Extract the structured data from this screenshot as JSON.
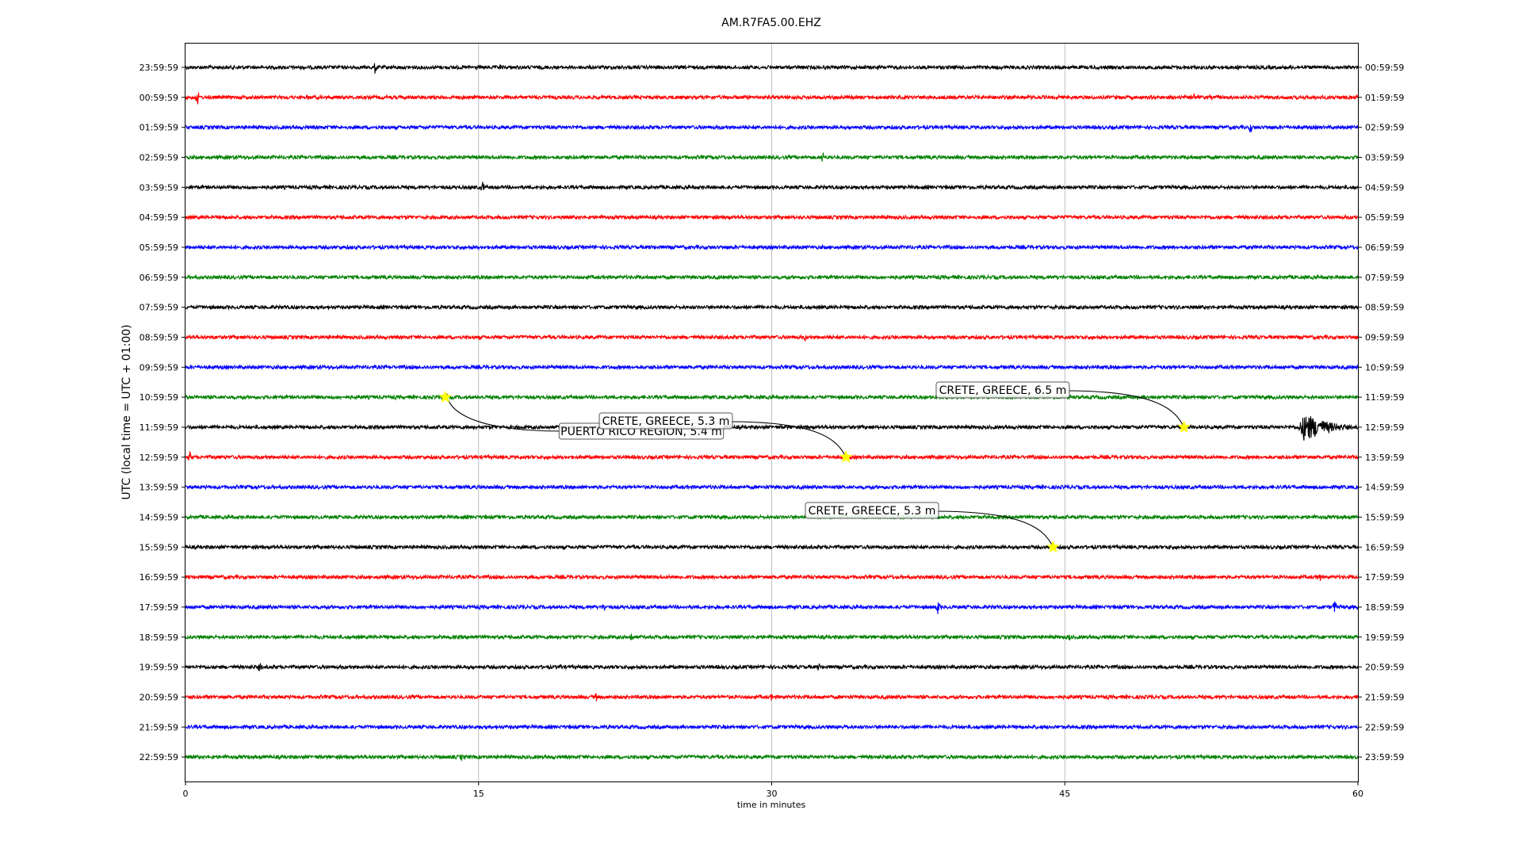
{
  "chart_data": {
    "type": "line",
    "title": "AM.R7FA5.00.EHZ",
    "xlabel": "time in minutes",
    "ylabel": "UTC (local time = UTC + 01:00)",
    "xlim": [
      0,
      60
    ],
    "xticks": [
      "0",
      "15",
      "30",
      "45",
      "60"
    ],
    "xtick_values": [
      0,
      15,
      30,
      45,
      60
    ],
    "grid_x": true,
    "grid_y": false,
    "line_colors": [
      "#000000",
      "#ff0000",
      "#0000ff",
      "#008000"
    ],
    "marker_color": "#ffff00",
    "left_labels": [
      "23:59:59",
      "00:59:59",
      "01:59:59",
      "02:59:59",
      "03:59:59",
      "04:59:59",
      "05:59:59",
      "06:59:59",
      "07:59:59",
      "08:59:59",
      "09:59:59",
      "10:59:59",
      "11:59:59",
      "12:59:59",
      "13:59:59",
      "14:59:59",
      "15:59:59",
      "16:59:59",
      "17:59:59",
      "18:59:59",
      "19:59:59",
      "20:59:59",
      "21:59:59",
      "22:59:59"
    ],
    "right_labels": [
      "00:59:59",
      "01:59:59",
      "02:59:59",
      "03:59:59",
      "04:59:59",
      "05:59:59",
      "06:59:59",
      "07:59:59",
      "08:59:59",
      "09:59:59",
      "10:59:59",
      "11:59:59",
      "12:59:59",
      "13:59:59",
      "14:59:59",
      "15:59:59",
      "16:59:59",
      "17:59:59",
      "18:59:59",
      "19:59:59",
      "20:59:59",
      "21:59:59",
      "22:59:59",
      "23:59:59"
    ],
    "spikes": [
      {
        "row": 0,
        "minute": 9.7,
        "amp": 0.5
      },
      {
        "row": 0,
        "minute": 16.1,
        "amp": 0.25
      },
      {
        "row": 1,
        "minute": 0.6,
        "amp": 0.6
      },
      {
        "row": 1,
        "minute": 51.6,
        "amp": 0.35
      },
      {
        "row": 2,
        "minute": 54.5,
        "amp": 0.45
      },
      {
        "row": 3,
        "minute": 32.6,
        "amp": 0.5
      },
      {
        "row": 4,
        "minute": 15.2,
        "amp": 0.5
      },
      {
        "row": 9,
        "minute": 31.7,
        "amp": 0.3
      },
      {
        "row": 13,
        "minute": 0.2,
        "amp": 0.45
      },
      {
        "row": 13,
        "minute": 40.0,
        "amp": 0.2
      },
      {
        "row": 17,
        "minute": 58.0,
        "amp": 0.5
      },
      {
        "row": 18,
        "minute": 21.4,
        "amp": 0.45
      },
      {
        "row": 18,
        "minute": 38.5,
        "amp": 0.65
      },
      {
        "row": 18,
        "minute": 58.8,
        "amp": 0.6
      },
      {
        "row": 19,
        "minute": 22.8,
        "amp": 0.5
      },
      {
        "row": 19,
        "minute": 45.2,
        "amp": 0.35
      },
      {
        "row": 20,
        "minute": 3.8,
        "amp": 0.4
      },
      {
        "row": 20,
        "minute": 19.2,
        "amp": 0.35
      },
      {
        "row": 20,
        "minute": 32.4,
        "amp": 0.3
      },
      {
        "row": 21,
        "minute": 21.0,
        "amp": 0.35
      },
      {
        "row": 21,
        "minute": 30.0,
        "amp": 0.3
      },
      {
        "row": 22,
        "minute": 33.8,
        "amp": 0.35
      },
      {
        "row": 23,
        "minute": 14.1,
        "amp": 0.3
      }
    ],
    "wave_packets": [
      {
        "row": 12,
        "start": 56.9,
        "end": 60,
        "amp": 1.05
      },
      {
        "row": 16,
        "start": 50.0,
        "end": 51.6,
        "amp": 0.18
      }
    ],
    "events": [
      {
        "label": "PUERTO RICO REGION, 5.4 m",
        "row": 11,
        "minute": 13.3
      },
      {
        "label": "CRETE, GREECE, 5.3 m",
        "row": 13,
        "minute": 33.8
      },
      {
        "label": "CRETE, GREECE, 6.5 m",
        "row": 12,
        "minute": 51.1
      },
      {
        "label": "CRETE, GREECE, 5.3 m",
        "row": 16,
        "minute": 44.4
      }
    ]
  }
}
